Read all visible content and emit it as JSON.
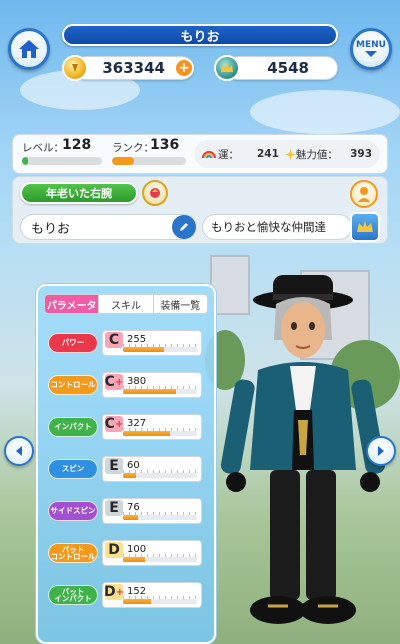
{
  "player": {
    "name": "もりお"
  },
  "currency": {
    "coins": "363344",
    "gems": "4548"
  },
  "menu": {
    "label": "MENU"
  },
  "profile": {
    "level_label": "レベル：",
    "level_value": "128",
    "level_progress": 0.08,
    "rank_label": "ランク：",
    "rank_value": "136",
    "rank_progress": 0.3,
    "luck_label": "運：",
    "luck_value": "241",
    "charm_label": "魅力値：",
    "charm_value": "393",
    "title": "年老いた右腕",
    "name_field": "もりお",
    "team_name": "もりおと愉快な仲間達"
  },
  "tabs": [
    {
      "label": "パラメータ",
      "active": true
    },
    {
      "label": "スキル",
      "active": false
    },
    {
      "label": "装備一覧",
      "active": false
    }
  ],
  "stats": [
    {
      "label": "パワー",
      "grade": "C",
      "plus": "",
      "value": "255",
      "color": "#e8384a",
      "fill": 0.55
    },
    {
      "label": "コントロール",
      "grade": "C",
      "plus": "+",
      "value": "380",
      "color": "#f39a1c",
      "fill": 0.72
    },
    {
      "label": "インパクト",
      "grade": "C",
      "plus": "+",
      "value": "327",
      "color": "#3fb24a",
      "fill": 0.64
    },
    {
      "label": "スピン",
      "grade": "E",
      "plus": "",
      "value": "60",
      "color": "#2f8fe0",
      "fill": 0.18
    },
    {
      "label": "サイドスピン",
      "grade": "E",
      "plus": "",
      "value": "76",
      "color": "#a24fd1",
      "fill": 0.2
    },
    {
      "label": "バット\nコントロール",
      "grade": "D",
      "plus": "",
      "value": "100",
      "color": "#f39a1c",
      "fill": 0.3
    },
    {
      "label": "バット\nインパクト",
      "grade": "D",
      "plus": "+",
      "value": "152",
      "color": "#3fb24a",
      "fill": 0.38
    }
  ],
  "colors": {
    "accent_blue": "#1d63c9",
    "tab_active": "#f25ca6",
    "level_bar": "#3fb24a",
    "rank_bar": "#f39a1c"
  },
  "icons": {
    "home": "home-icon",
    "coin": "coin-icon",
    "gem": "crown-medal-icon",
    "add": "plus-icon",
    "rainbow": "rainbow-icon",
    "star": "star-icon",
    "edit": "pencil-icon",
    "prev": "chevron-left-icon",
    "next": "chevron-right-icon"
  }
}
